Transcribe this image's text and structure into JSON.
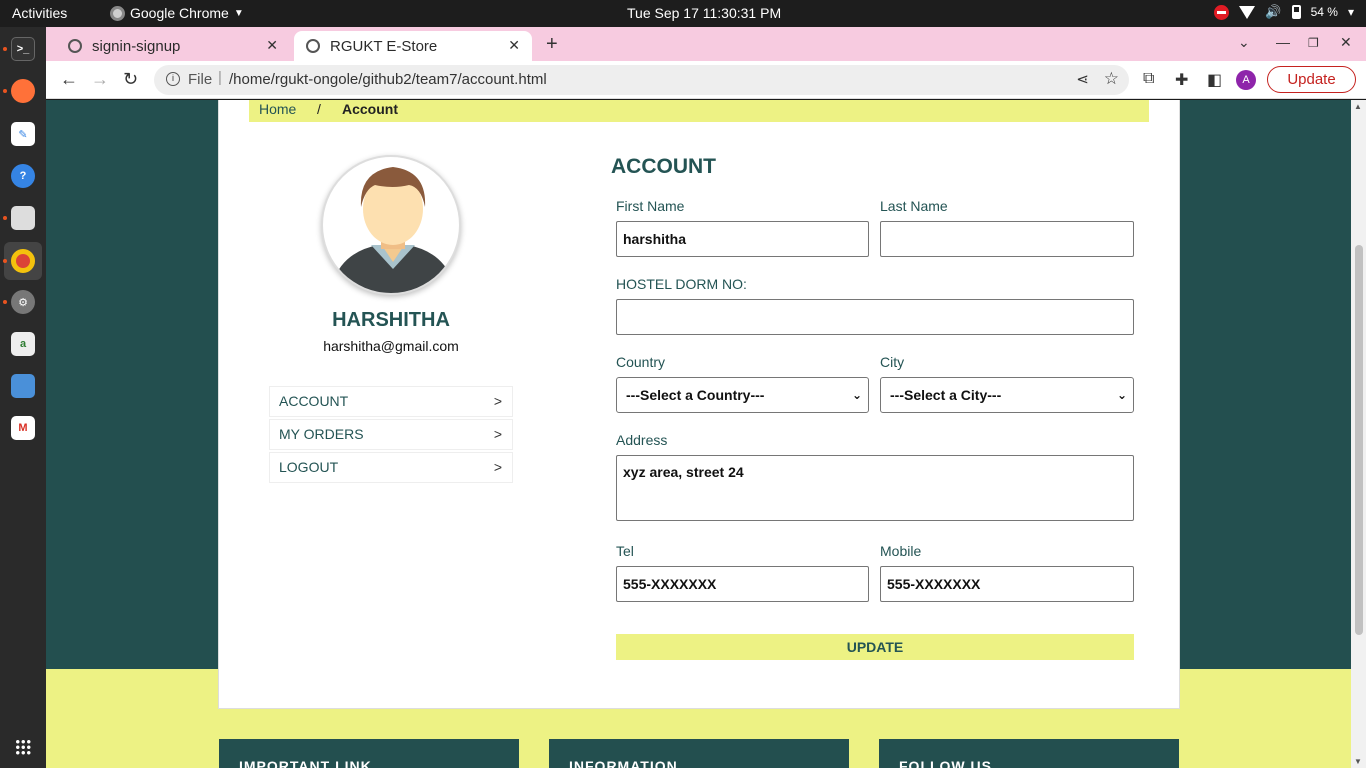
{
  "system": {
    "activities": "Activities",
    "app_name": "Google Chrome",
    "clock": "Tue Sep 17  11:30:31 PM",
    "battery": "54 %"
  },
  "browser": {
    "tabs": [
      {
        "title": "signin-signup"
      },
      {
        "title": "RGUKT E-Store"
      }
    ],
    "url_scheme": "File",
    "url": "/home/rgukt-ongole/github2/team7/account.html",
    "profile_initial": "A",
    "update_label": "Update"
  },
  "page": {
    "breadcrumb": {
      "home": "Home",
      "sep": "/",
      "current": "Account"
    },
    "profile": {
      "name": "HARSHITHA",
      "email": "harshitha@gmail.com"
    },
    "menu": [
      {
        "label": "ACCOUNT",
        "arrow": ">"
      },
      {
        "label": "MY ORDERS",
        "arrow": ">"
      },
      {
        "label": "LOGOUT",
        "arrow": ">"
      }
    ],
    "form": {
      "title": "ACCOUNT",
      "first_name_label": "First Name",
      "first_name_value": "harshitha",
      "last_name_label": "Last Name",
      "last_name_value": "",
      "hostel_label": "HOSTEL DORM NO:",
      "hostel_value": "",
      "country_label": "Country",
      "country_value": "---Select a Country---",
      "city_label": "City",
      "city_value": "---Select a City---",
      "address_label": "Address",
      "address_value": "xyz area, street 24",
      "tel_label": "Tel",
      "tel_value": "555-XXXXXXX",
      "mobile_label": "Mobile",
      "mobile_value": "555-XXXXXXX",
      "update_label": "UPDATE"
    },
    "footer": [
      "IMPORTANT LINK",
      "INFORMATION",
      "FOLLOW US"
    ]
  },
  "colors": {
    "page_bg": "#234f4f",
    "accent_yellow": "#edf284",
    "text_teal": "#245454",
    "tabstrip": "#f7cbe0"
  }
}
